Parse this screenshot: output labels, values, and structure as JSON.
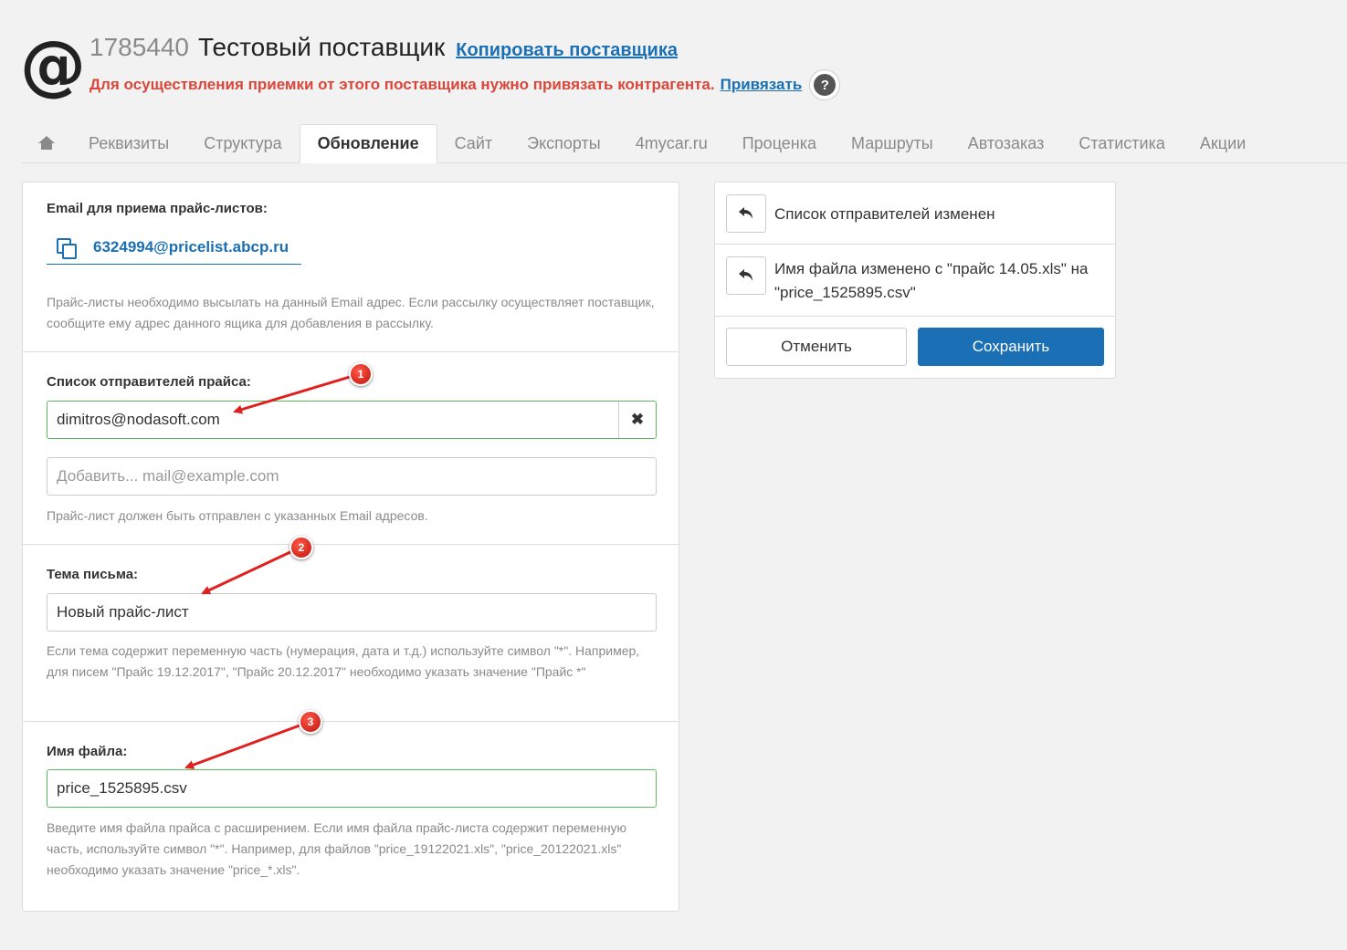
{
  "header": {
    "logo_glyph": "@",
    "supplier_id": "1785440",
    "supplier_name": "Тестовый поставщик",
    "copy_link": "Копировать поставщика",
    "warning": "Для осуществления приемки от этого поставщика нужно привязать контрагента.",
    "bind_link": "Привязать",
    "help_glyph": "?"
  },
  "tabs": [
    {
      "label": "",
      "icon": "home-icon"
    },
    {
      "label": "Реквизиты"
    },
    {
      "label": "Структура"
    },
    {
      "label": "Обновление",
      "active": true
    },
    {
      "label": "Сайт"
    },
    {
      "label": "Экспорты"
    },
    {
      "label": "4mycar.ru"
    },
    {
      "label": "Проценка"
    },
    {
      "label": "Маршруты"
    },
    {
      "label": "Автозаказ"
    },
    {
      "label": "Статистика"
    },
    {
      "label": "Акции"
    }
  ],
  "email_section": {
    "label": "Email для приема прайс-листов:",
    "email": "6324994@pricelist.abcp.ru",
    "help": "Прайс-листы необходимо высылать на данный Email адрес. Если рассылку осуществляет поставщик, сообщите ему адрес данного ящика для добавления в рассылку."
  },
  "senders_section": {
    "label": "Список отправителей прайса:",
    "sender_value": "dimitros@nodasoft.com",
    "clear_glyph": "✖",
    "add_placeholder": "Добавить... mail@example.com",
    "help": "Прайс-лист должен быть отправлен с указанных Email адресов."
  },
  "subject_section": {
    "label": "Тема письма:",
    "value": "Новый прайс-лист",
    "help": "Если тема содержит переменную часть (нумерация, дата и т.д.) используйте символ \"*\". Например, для писем \"Прайс 19.12.2017\", \"Прайс 20.12.2017\" необходимо указать значение \"Прайс *\""
  },
  "filename_section": {
    "label": "Имя файла:",
    "value": "price_1525895.csv",
    "help": "Введите имя файла прайса с расширением. Если имя файла прайс-листа содержит переменную часть, используйте символ \"*\". Например, для файлов \"price_19122021.xls\", \"price_20122021.xls\" необходимо указать значение \"price_*.xls\"."
  },
  "changes": {
    "items": [
      {
        "text": "Список отправителей изменен"
      },
      {
        "text": "Имя файла изменено с \"прайс 14.05.xls\" на \"price_1525895.csv\""
      }
    ],
    "cancel_label": "Отменить",
    "save_label": "Сохранить"
  },
  "annotations": {
    "markers": [
      "1",
      "2",
      "3"
    ],
    "color": "#e02020"
  },
  "colors": {
    "accent": "#1a6fb5",
    "warning": "#d9473a",
    "valid_border": "#5cb85c"
  }
}
